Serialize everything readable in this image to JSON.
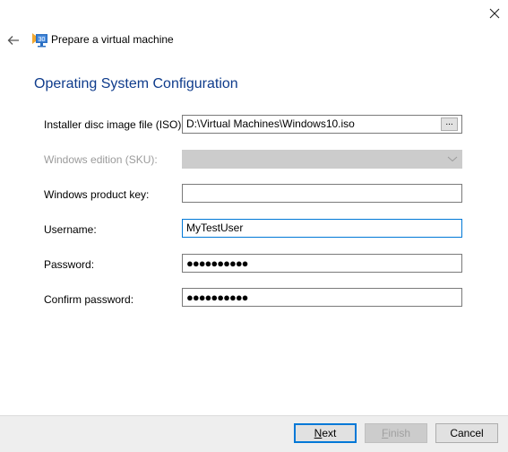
{
  "window": {
    "title": "Prepare a virtual machine",
    "close_icon": "close-icon",
    "back_icon": "back-arrow-icon",
    "app_icon": "virtual-machine-icon"
  },
  "page": {
    "heading": "Operating System Configuration"
  },
  "form": {
    "iso": {
      "label": "Installer disc image file (ISO):",
      "value": "D:\\Virtual Machines\\Windows10.iso",
      "browse_label": "..."
    },
    "sku": {
      "label": "Windows edition (SKU):",
      "value": "",
      "disabled": true
    },
    "product_key": {
      "label": "Windows product key:",
      "value": ""
    },
    "username": {
      "label": "Username:",
      "value": "MyTestUser"
    },
    "password": {
      "label": "Password:",
      "masked_value": "●●●●●●●●●●"
    },
    "confirm_password": {
      "label": "Confirm password:",
      "masked_value": "●●●●●●●●●●"
    }
  },
  "footer": {
    "next": {
      "mnemonic": "N",
      "rest": "ext"
    },
    "finish": {
      "mnemonic": "F",
      "rest": "inish"
    },
    "cancel": "Cancel"
  },
  "colors": {
    "accent": "#0078d7",
    "heading": "#0f3c8c",
    "footer_bg": "#eeeeee"
  }
}
